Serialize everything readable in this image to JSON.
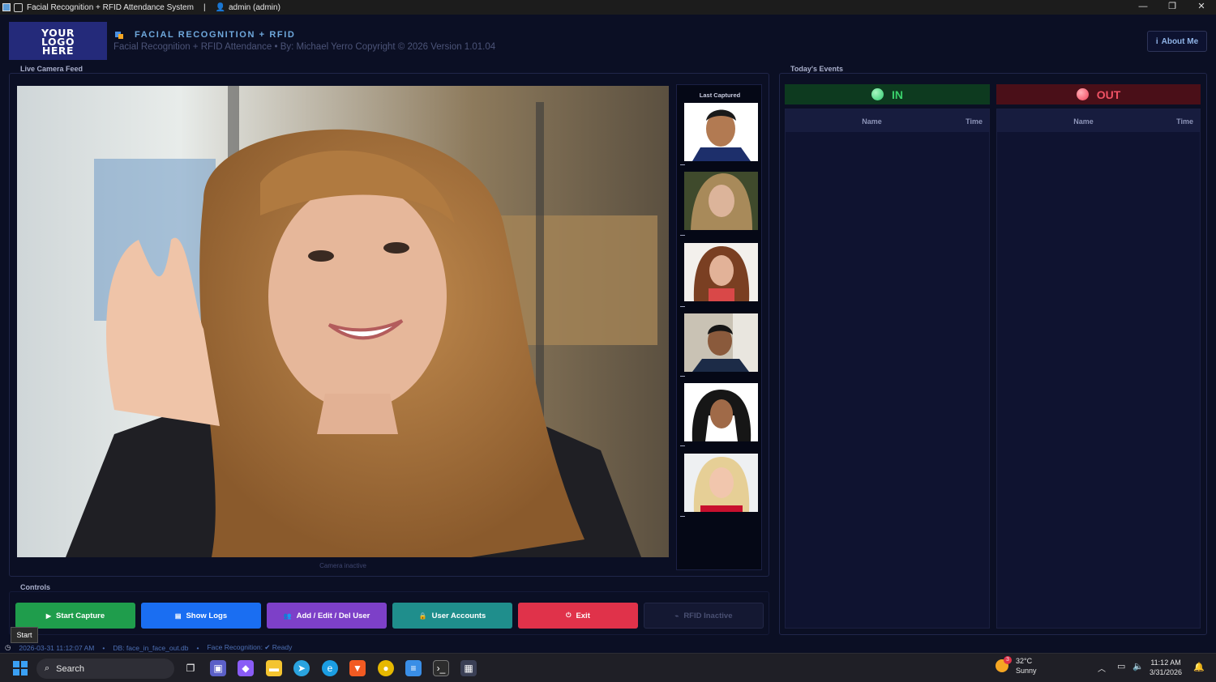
{
  "window": {
    "title": "Facial Recognition + RFID Attendance System",
    "separator": "|",
    "user": "admin  (admin)",
    "controls": {
      "minimize": "—",
      "maximize": "❐",
      "close": "✕"
    }
  },
  "header": {
    "logo_line1": "YOUR",
    "logo_line2": "LOGO",
    "logo_line3": "HERE",
    "title": "FACIAL RECOGNITION + RFID",
    "subtitle": "Facial Recognition + RFID Attendance  •  By: Michael Yerro Copyright © 2026 Version 1.01.04",
    "about_label": "About Me",
    "about_icon": "info-icon"
  },
  "camera_panel": {
    "title": "Live Camera Feed",
    "caption": "Camera inactive",
    "last_captured_title": "Last Captured",
    "thumb_count": 6
  },
  "controls_panel": {
    "title": "Controls",
    "buttons": [
      {
        "label": "Start Capture",
        "icon": "play-icon",
        "color": "#1f9d4c"
      },
      {
        "label": "Show Logs",
        "icon": "document-icon",
        "color": "#1a6ef2"
      },
      {
        "label": "Add / Edit / Del User",
        "icon": "users-icon",
        "color": "#7d40c8"
      },
      {
        "label": "User Accounts",
        "icon": "lock-icon",
        "color": "#1f8e8c"
      },
      {
        "label": "Exit",
        "icon": "power-icon",
        "color": "#e0324a"
      },
      {
        "label": "RFID  Inactive",
        "icon": "rfid-icon",
        "color": "#141832"
      }
    ]
  },
  "events_panel": {
    "title": "Today's Events",
    "in_label": "IN",
    "out_label": "OUT",
    "in_color": "#3ad06b",
    "out_color": "#f05264",
    "col_name": "Name",
    "col_time": "Time"
  },
  "statusbar": {
    "datetime": "2026-03-31   11:12:07 AM",
    "db": "DB: face_in_face_out.db",
    "face": "Face Recognition: ✔ Ready",
    "bullet": "•"
  },
  "tooltip": "Start",
  "taskbar": {
    "search_placeholder": "Search",
    "weather_temp": "32°C",
    "weather_desc": "Sunny",
    "weather_badge": "3",
    "time": "11:12 AM",
    "date": "3/31/2026"
  }
}
